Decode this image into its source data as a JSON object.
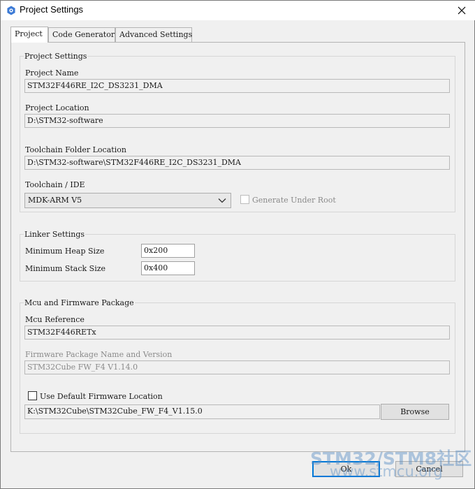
{
  "window": {
    "title": "Project Settings",
    "icon": "gear-icon",
    "close_icon": "close-icon"
  },
  "tabs": [
    {
      "label": "Project",
      "active": true
    },
    {
      "label": "Code Generator",
      "active": false
    },
    {
      "label": "Advanced Settings",
      "active": false
    }
  ],
  "project_settings": {
    "group_title": "Project Settings",
    "project_name_label": "Project Name",
    "project_name": "STM32F446RE_I2C_DS3231_DMA",
    "project_location_label": "Project Location",
    "project_location": "D:\\STM32-software",
    "toolchain_folder_label": "Toolchain Folder Location",
    "toolchain_folder": "D:\\STM32-software\\STM32F446RE_I2C_DS3231_DMA",
    "toolchain_ide_label": "Toolchain / IDE",
    "toolchain_ide_selected": "MDK-ARM V5",
    "generate_under_root_label": "Generate Under Root",
    "generate_under_root_checked": false
  },
  "linker_settings": {
    "group_title": "Linker Settings",
    "min_heap_label": "Minimum Heap Size",
    "min_heap_value": "0x200",
    "min_stack_label": "Minimum Stack Size",
    "min_stack_value": "0x400"
  },
  "mcu_firmware": {
    "group_title": "Mcu and Firmware Package",
    "mcu_reference_label": "Mcu Reference",
    "mcu_reference": "STM32F446RETx",
    "firmware_package_label": "Firmware Package Name and Version",
    "firmware_package": "STM32Cube FW_F4 V1.14.0",
    "use_default_location_label": "Use Default Firmware Location",
    "use_default_location_checked": false,
    "firmware_location": "K:\\STM32Cube\\STM32Cube_FW_F4_V1.15.0",
    "browse_label": "Browse"
  },
  "footer": {
    "ok_label": "Ok",
    "cancel_label": "Cancel"
  },
  "watermark": {
    "title": "STM32/STM8社区",
    "url": "www.stmcu.org"
  },
  "colors": {
    "window_bg": "#f0f0f0",
    "titlebar_bg": "#ffffff",
    "default_button_border": "#0078d7"
  }
}
